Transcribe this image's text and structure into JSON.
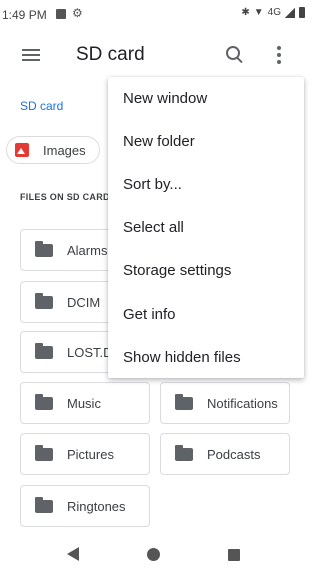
{
  "status_bar": {
    "time": "1:49 PM",
    "network": "4G"
  },
  "app_bar": {
    "title": "SD card"
  },
  "breadcrumb": "SD card",
  "chip": {
    "label": "Images"
  },
  "section_title": "FILES ON SD CARD",
  "folders": [
    "Alarms",
    "DCIM",
    "LOST.DIR",
    "Music",
    "Notifications",
    "Pictures",
    "Podcasts",
    "Ringtones"
  ],
  "menu": {
    "items": [
      "New window",
      "New folder",
      "Sort by...",
      "Select all",
      "Storage settings",
      "Get info",
      "Show hidden files"
    ]
  }
}
